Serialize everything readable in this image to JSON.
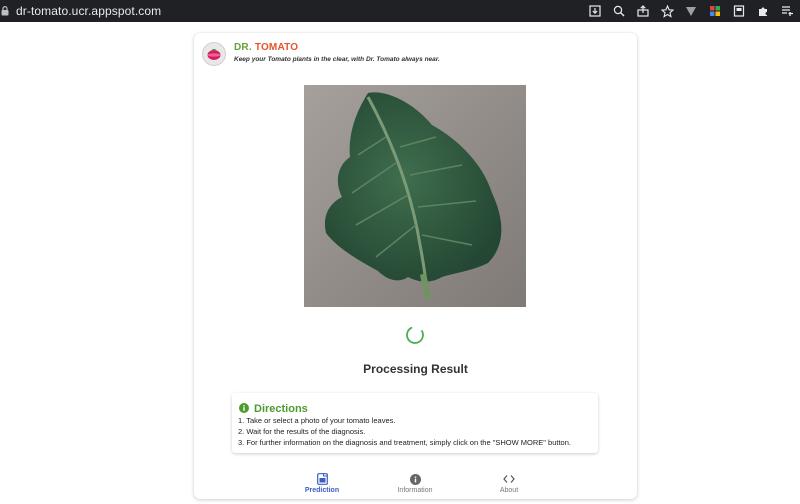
{
  "browser": {
    "url": "dr-tomato.ucr.appspot.com",
    "icons": [
      "download-icon",
      "zoom-icon",
      "share-icon",
      "bookmark-star-icon",
      "extension-v-icon",
      "extension-grid-icon",
      "extension-book-icon",
      "puzzle-extensions-icon",
      "reading-list-icon"
    ]
  },
  "app": {
    "title_part1": "DR.",
    "title_part2": "TOMATO",
    "tagline": "Keep your Tomato plants in the clear, with Dr. Tomato always near.",
    "accent_green": "#6aa13a",
    "accent_orange": "#e2552a"
  },
  "main": {
    "status_text": "Processing Result"
  },
  "directions": {
    "title": "Directions",
    "steps": [
      "1. Take or select a photo of your tomato leaves.",
      "2. Wait for the results of the diagnosis.",
      "3. For further information on the diagnosis and treatment, simply click on the \"SHOW MORE\" button."
    ]
  },
  "nav": {
    "items": [
      {
        "label": "Prediction",
        "icon": "prediction-icon",
        "active": true
      },
      {
        "label": "Information",
        "icon": "info-icon",
        "active": false
      },
      {
        "label": "About",
        "icon": "code-icon",
        "active": false
      }
    ],
    "active_color": "#3b5fc0"
  }
}
